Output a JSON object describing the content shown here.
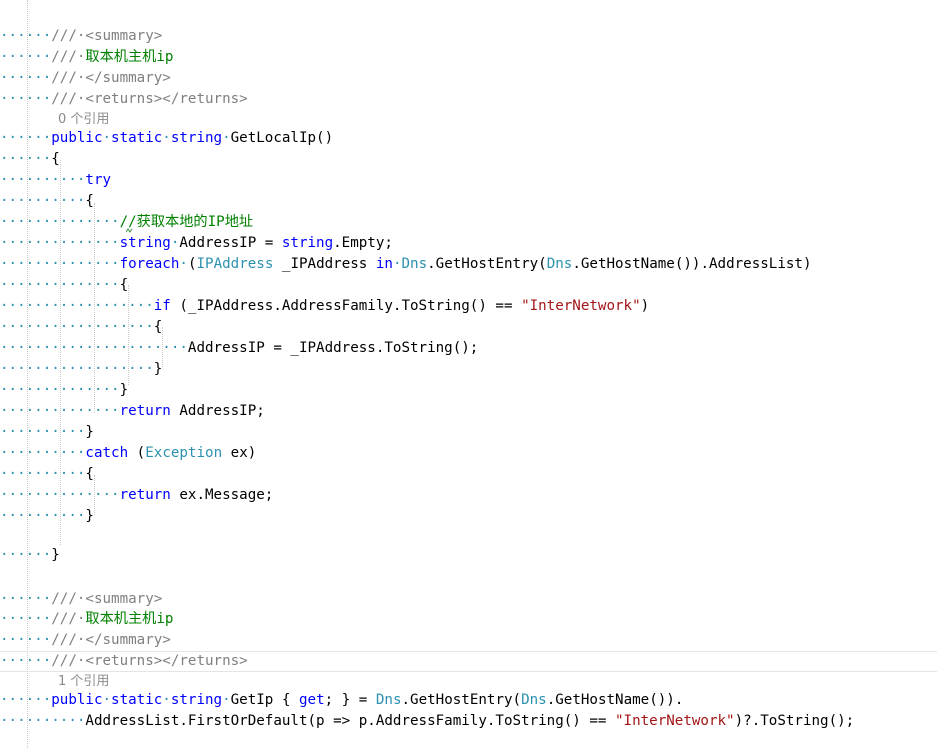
{
  "editor": {
    "colors": {
      "keyword": "#0000ff",
      "type": "#2b91af",
      "string": "#a31515",
      "comment": "#008000",
      "xmldoc": "#808080",
      "codelens": "#8a8a8a",
      "whitespace_dots": "#2b91af"
    },
    "method1": {
      "doc_summary_open": "<summary>",
      "doc_text": "取本机主机ip",
      "doc_summary_close": "</summary>",
      "doc_returns": "<returns></returns>",
      "codelens": "0 个引用",
      "signature": {
        "kw_public": "public",
        "kw_static": "static",
        "kw_string": "string",
        "name": "GetLocalIp()"
      },
      "open_brace": "{",
      "try_kw": "try",
      "try_open": "{",
      "comment": "//获取本地的IP地址",
      "decl": {
        "kw": "string",
        "rest": "AddressIP = ",
        "kw2": "string",
        "rest2": ".Empty;"
      },
      "foreach": {
        "kw": "foreach",
        "paren": "(",
        "type": "IPAddress",
        "var": " _IPAddress ",
        "kw_in": "in",
        "type2": "Dns",
        "call1": ".GetHostEntry(",
        "type3": "Dns",
        "call2": ".GetHostName()).AddressList)"
      },
      "foreach_open": "{",
      "if_line": {
        "kw": "if",
        "cond": " (_IPAddress.AddressFamily.ToString() == ",
        "str": "\"InterNetwork\"",
        "end": ")"
      },
      "if_open": "{",
      "assign": "AddressIP = _IPAddress.ToString();",
      "if_close": "}",
      "foreach_close": "}",
      "return1": {
        "kw": "return",
        "rest": " AddressIP;"
      },
      "try_close": "}",
      "catch": {
        "kw": "catch",
        "paren": " (",
        "type": "Exception",
        "rest": " ex)"
      },
      "catch_open": "{",
      "return2": {
        "kw": "return",
        "rest": " ex.Message;"
      },
      "catch_close": "}",
      "close_brace": "}"
    },
    "method2": {
      "doc_summary_open": "<summary>",
      "doc_text": "取本机主机ip",
      "doc_summary_close": "</summary>",
      "doc_returns": "<returns></returns>",
      "codelens": "1 个引用",
      "line1": {
        "kw_public": "public",
        "kw_static": "static",
        "kw_string": "string",
        "name": "GetIp { ",
        "kw_get": "get",
        "mid": "; } = ",
        "type1": "Dns",
        "call1": ".GetHostEntry(",
        "type2": "Dns",
        "call2": ".GetHostName())."
      },
      "line2": {
        "pre": "AddressList.FirstOrDefault(p => p.AddressFamily.ToString() == ",
        "str": "\"InterNetwork\"",
        "post": ")?.ToString();"
      }
    }
  }
}
